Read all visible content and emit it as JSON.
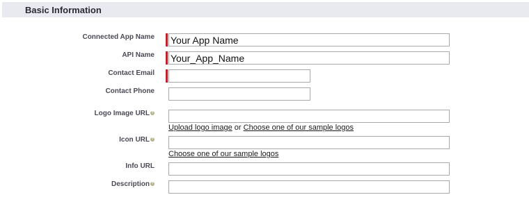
{
  "section": {
    "title": "Basic Information"
  },
  "fields": {
    "connected_app_name": {
      "label": "Connected App Name",
      "value": "Your App Name",
      "required": true
    },
    "api_name": {
      "label": "API Name",
      "value": "Your_App_Name",
      "required": true
    },
    "contact_email": {
      "label": "Contact Email",
      "value": "",
      "required": true
    },
    "contact_phone": {
      "label": "Contact Phone",
      "value": ""
    },
    "logo_image_url": {
      "label": "Logo Image URL",
      "value": "",
      "upload_link": "Upload logo image",
      "or_text": "or",
      "sample_link": "Choose one of our sample logos"
    },
    "icon_url": {
      "label": "Icon URL",
      "value": "",
      "sample_link": "Choose one of our sample logos"
    },
    "info_url": {
      "label": "Info URL",
      "value": ""
    },
    "description": {
      "label": "Description",
      "value": ""
    }
  },
  "icons": {
    "help": "help-icon"
  },
  "colors": {
    "required_bar": "#c0202a",
    "section_bg": "#e8eaf0"
  }
}
